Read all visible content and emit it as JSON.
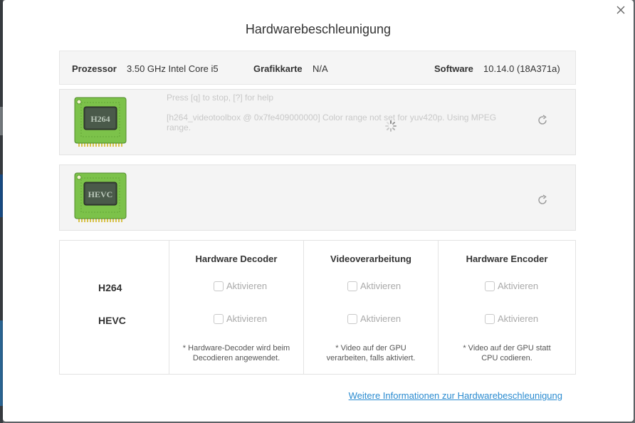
{
  "dialog": {
    "title": "Hardwarebeschleunigung",
    "close_icon": "close-icon"
  },
  "info": {
    "processor_label": "Prozessor",
    "processor_value": "3.50 GHz Intel Core i5",
    "graphics_label": "Grafikkarte",
    "graphics_value": "N/A",
    "software_label": "Software",
    "software_value": "10.14.0 (18A371a)"
  },
  "cards": [
    {
      "chip_label": "H264",
      "log_line1": "Press [q] to stop, [?] for help",
      "log_line2": "[h264_videotoolbox @ 0x7fe409000000] Color range not set for yuv420p. Using MPEG",
      "log_line3": "range.",
      "loading": true,
      "refresh_icon": "refresh-icon"
    },
    {
      "chip_label": "HEVC",
      "refresh_icon": "refresh-icon"
    }
  ],
  "settings": {
    "columns": [
      "Hardware Decoder",
      "Videoverarbeitung",
      "Hardware Encoder"
    ],
    "rows": [
      "H264",
      "HEVC"
    ],
    "checkbox_label": "Aktivieren",
    "notes": [
      [
        "* Hardware-Decoder wird beim",
        "Decodieren angewendet."
      ],
      [
        "* Video auf der GPU",
        "verarbeiten, falls aktiviert."
      ],
      [
        "* Video auf der GPU statt",
        "CPU codieren."
      ]
    ]
  },
  "link": {
    "text": "Weitere Informationen zur Hardwarebeschleunigung"
  },
  "colors": {
    "accent_link": "#2a8bd0",
    "chip_green": "#7cc24a"
  }
}
